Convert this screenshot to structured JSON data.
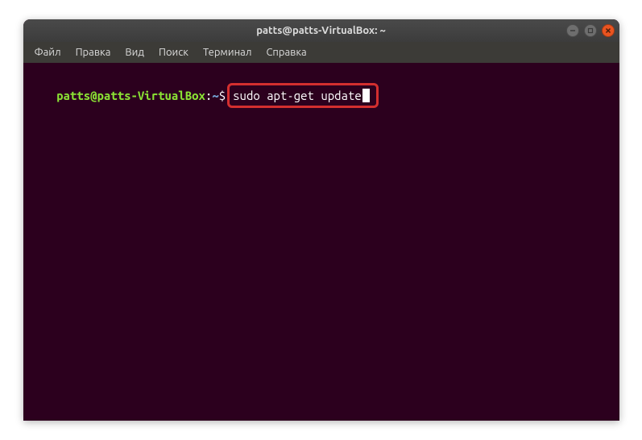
{
  "window": {
    "title": "patts@patts-VirtualBox: ~"
  },
  "menu": {
    "file": "Файл",
    "edit": "Правка",
    "view": "Вид",
    "search": "Поиск",
    "terminal": "Терминал",
    "help": "Справка"
  },
  "terminal": {
    "prompt_user": "patts@patts-VirtualBox",
    "prompt_colon": ":",
    "prompt_path": "~",
    "prompt_dollar": "$",
    "command": "sudo apt-get update"
  },
  "window_controls": {
    "minimize": "−",
    "maximize": "□",
    "close": "×"
  }
}
